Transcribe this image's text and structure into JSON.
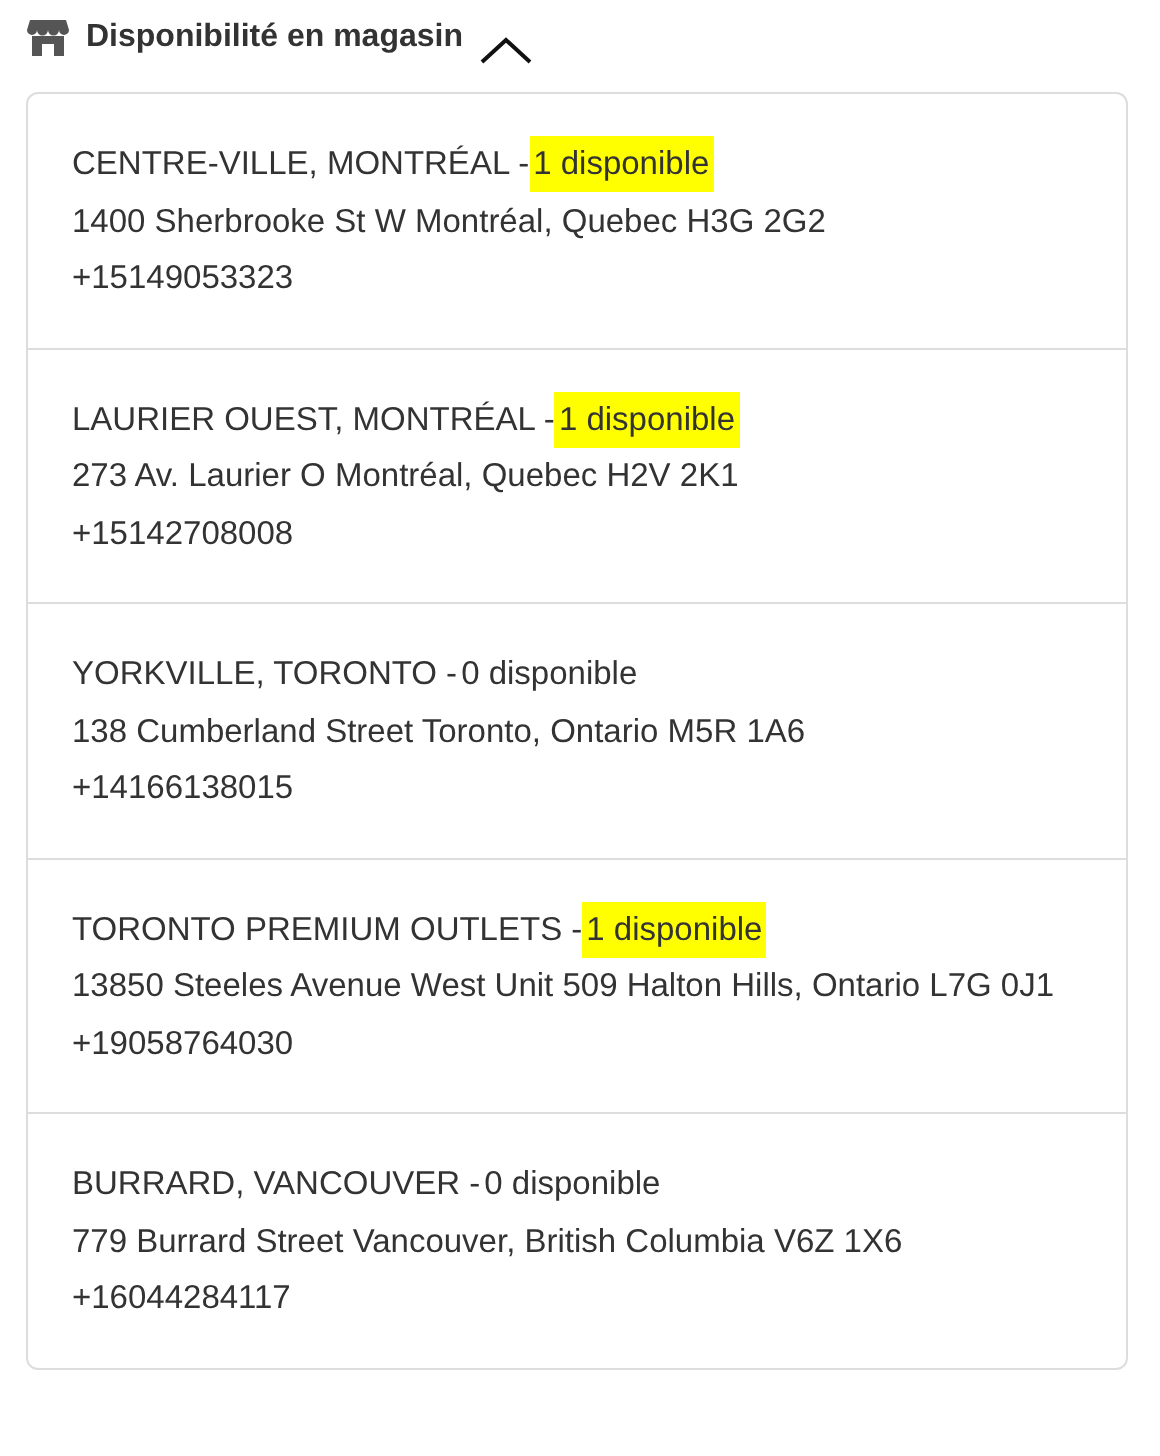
{
  "section": {
    "title": "Disponibilité en magasin",
    "expanded": true
  },
  "stores": [
    {
      "heading": "CENTRE-VILLE, MONTRÉAL -",
      "availability": "1 disponible",
      "highlighted": true,
      "address": "1400 Sherbrooke St W Montréal, Quebec H3G 2G2",
      "phone": "+15149053323"
    },
    {
      "heading": "LAURIER OUEST, MONTRÉAL -",
      "availability": "1 disponible",
      "highlighted": true,
      "address": "273 Av. Laurier O Montréal, Quebec H2V 2K1",
      "phone": "+15142708008"
    },
    {
      "heading": "YORKVILLE, TORONTO -",
      "availability": "0 disponible",
      "highlighted": false,
      "address": "138 Cumberland Street Toronto, Ontario M5R 1A6",
      "phone": "+14166138015"
    },
    {
      "heading": "TORONTO PREMIUM OUTLETS -",
      "availability": "1 disponible",
      "highlighted": true,
      "address": "13850 Steeles Avenue West Unit 509 Halton Hills, Ontario L7G 0J1",
      "phone": "+19058764030"
    },
    {
      "heading": "BURRARD, VANCOUVER -",
      "availability": "0 disponible",
      "highlighted": false,
      "address": "779 Burrard Street Vancouver, British Columbia V6Z 1X6",
      "phone": "+16044284117"
    }
  ]
}
